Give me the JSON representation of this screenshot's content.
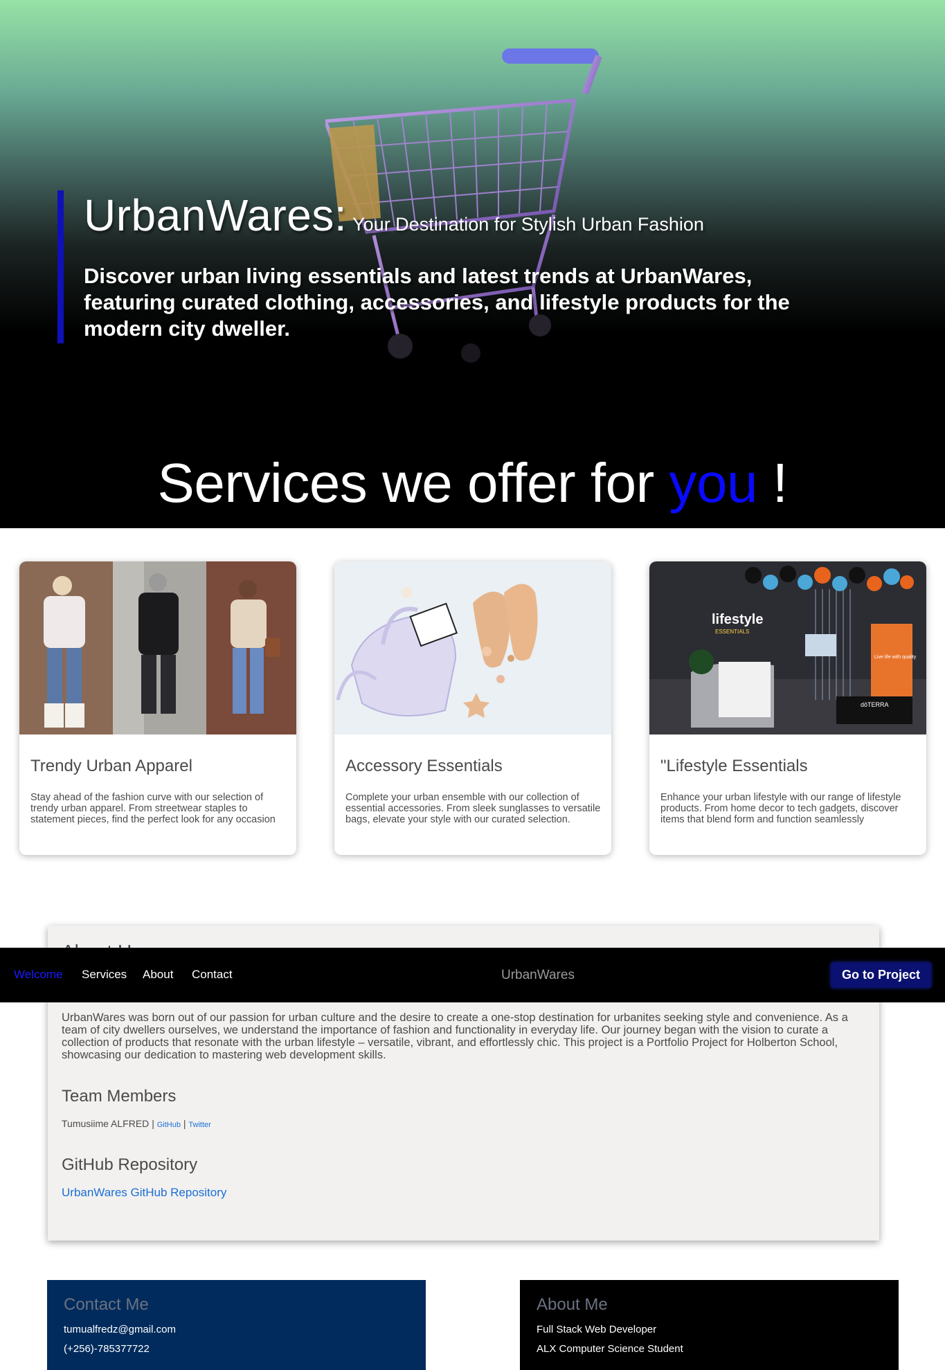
{
  "hero": {
    "title": "UrbanWares:",
    "tagline": "Your Destination for Stylish Urban Fashion",
    "description": "Discover urban living essentials and latest trends at UrbanWares, featuring curated clothing, accessories, and lifestyle products for the modern city dweller."
  },
  "services": {
    "heading_prefix": "Services we offer for",
    "heading_accent": "you",
    "heading_suffix": "!",
    "cards": [
      {
        "title": "Trendy Urban Apparel",
        "text": "Stay ahead of the fashion curve with our selection of trendy urban apparel. From streetwear staples to statement pieces, find the perfect look for any occasion"
      },
      {
        "title": "Accessory Essentials",
        "text": "Complete your urban ensemble with our collection of essential accessories. From sleek sunglasses to versatile bags, elevate your style with our curated selection."
      },
      {
        "title": "\"Lifestyle Essentials",
        "text": "Enhance your urban lifestyle with our range of lifestyle products. From home decor to tech gadgets, discover items that blend form and function seamlessly"
      }
    ],
    "store_sign": "lifestyle",
    "store_sign_sub": "ESSENTIALS",
    "store_brand": "dōTERRA",
    "store_poster": "Live life with quality"
  },
  "about": {
    "title": "About Us",
    "text": "UrbanWares was born out of our passion for urban culture and the desire to create a one-stop destination for urbanites seeking style and convenience. As a team of city dwellers ourselves, we understand the importance of fashion and functionality in everyday life. Our journey began with the vision to curate a collection of products that resonate with the urban lifestyle – versatile, vibrant, and effortlessly chic. This project is a Portfolio Project for Holberton School, showcasing our dedication to mastering web development skills.",
    "team_title": "Team Members",
    "member_name": "Tumusiime ALFRED",
    "separator": "|",
    "github_label": "GitHub",
    "twitter_label": "Twitter",
    "repo_title": "GitHub Repository",
    "repo_link": "UrbanWares GitHub Repository"
  },
  "navbar": {
    "items": [
      "Welcome",
      "Services",
      "About",
      "Contact"
    ],
    "active": "Welcome",
    "brand": "UrbanWares",
    "cta": "Go to Project"
  },
  "footer": {
    "contact_title": "Contact Me",
    "email": "tumualfredz@gmail.com",
    "phone": "(+256)-785377722",
    "about_title": "About Me",
    "role": "Full Stack Web Developer",
    "education": "ALX Computer Science Student"
  },
  "colors": {
    "accent_blue": "#0a0aff",
    "nav_button": "#0a1170",
    "link_blue": "#1a6fd6",
    "footer_left": "#002b5c",
    "footer_right": "#000000"
  }
}
